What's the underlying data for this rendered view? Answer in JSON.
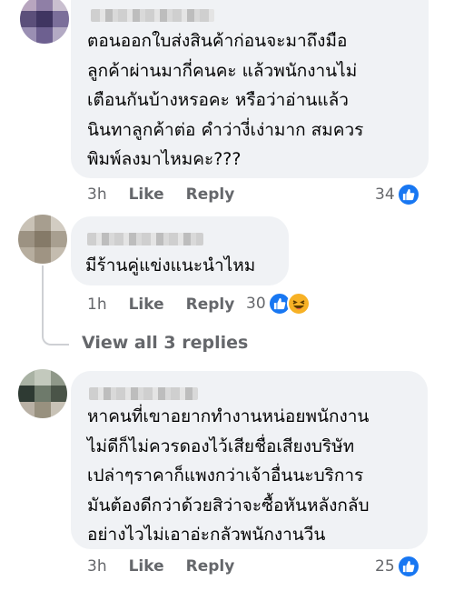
{
  "comments": [
    {
      "text": "ตอนออกใบส่งสินค้าก่อนจะมาถึงมือ\nลูกค้าผ่านมากี่คนคะ แล้วพนักงานไม่\nเตือนกันบ้างหรอคะ หรือว่าอ่านแล้ว\nนินทาลูกค้าต่อ คำว่างี่เง่ามาก สมควร\nพิมพ์ลงมาไหมคะ???",
      "time": "3h",
      "like_label": "Like",
      "reply_label": "Reply",
      "reaction_count": "34"
    },
    {
      "text": "มีร้านคู่แข่งแนะนำไหม",
      "time": "1h",
      "like_label": "Like",
      "reply_label": "Reply",
      "reaction_count": "30"
    },
    {
      "text": "หาคนที่เขาอยากทำงานหน่อยพนักงาน\nไม่ดีก็ไม่ควรดองไว้เสียชื่อเสียงบริษัท\nเปล่าๆราคาก็แพงกว่าเจ้าอื่นนะบริการ\nมันต้องดีกว่าด้วยสิว่าจะซื้อหันหลังกลับ\nอย่างไวไม่เอาอ่ะกลัวพนักงานวีน",
      "time": "3h",
      "like_label": "Like",
      "reply_label": "Reply",
      "reaction_count": "25"
    }
  ],
  "view_replies_label": "View all 3 replies",
  "icons": {
    "like_reaction": "thumbs-up-icon",
    "haha_reaction": "haha-emoji-icon"
  },
  "colors": {
    "bubble": "#f0f2f5",
    "meta_text": "#65676b",
    "like_blue": "#1877f2",
    "haha_yellow": "#f7b125"
  }
}
